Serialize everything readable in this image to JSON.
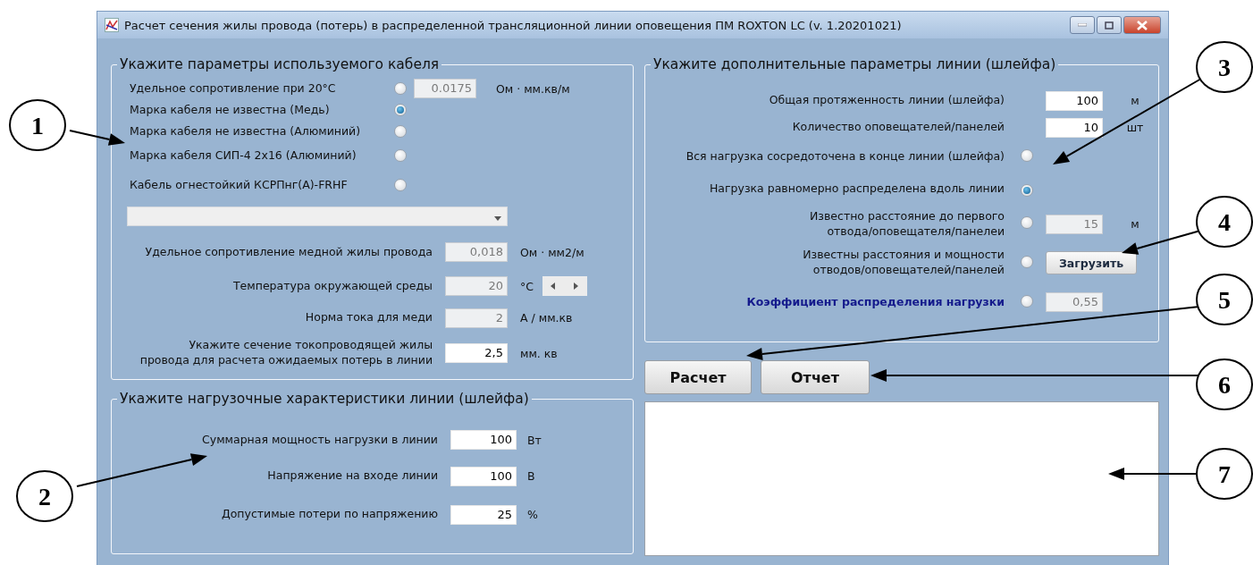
{
  "window": {
    "title": "Расчет сечения жилы провода (потерь) в распределенной трансляционной линии оповещения ПМ ROXTON LC (v. 1.20201021)"
  },
  "cable": {
    "title": "Укажите параметры используемого кабеля",
    "options": [
      {
        "label": "Удельное сопротивление при 20°С",
        "selected": false,
        "value": "0.0175",
        "unit": "Ом · мм.кв/м",
        "disabled": true
      },
      {
        "label": "Марка кабеля не известна (Медь)",
        "selected": true
      },
      {
        "label": "Марка кабеля не известна (Алюминий)",
        "selected": false
      },
      {
        "label": "Марка кабеля  СИП-4 2х16 (Алюминий)",
        "selected": false
      },
      {
        "label": "Кабель огнестойкий КСРПнг(А)-FRHF",
        "selected": false
      }
    ],
    "params": [
      {
        "kind": "field",
        "label": "Удельное сопротивление медной жилы провода",
        "value": "0,018",
        "unit": "Ом · мм2/м",
        "disabled": true
      },
      {
        "kind": "spinner",
        "label": "Температура окружающей среды",
        "value": "20",
        "unit": "°C",
        "disabled": true
      },
      {
        "kind": "field",
        "label": "Норма тока для меди",
        "value": "2",
        "unit": "А / мм.кв",
        "disabled": true
      },
      {
        "kind": "field",
        "label": "Укажите сечение токопроводящей жилы провода для расчета ожидаемых потерь в линии",
        "value": "2,5",
        "unit": "мм. кв",
        "disabled": false
      }
    ]
  },
  "load": {
    "title": "Укажите нагрузочные характеристики линии (шлейфа)",
    "fields": [
      {
        "label": "Суммарная мощность нагрузки в линии",
        "value": "100",
        "unit": "Вт"
      },
      {
        "label": "Напряжение на входе линии",
        "value": "100",
        "unit": "В"
      },
      {
        "label": "Допустимые потери по напряжению",
        "value": "25",
        "unit": "%"
      }
    ]
  },
  "line": {
    "title": "Укажите дополнительные параметры линии (шлейфа)",
    "fields": [
      {
        "label": "Общая протяженность линии (шлейфа)",
        "value": "100",
        "unit": "м"
      },
      {
        "label": "Количество оповещателей/панелей",
        "value": "10",
        "unit": "шт"
      }
    ],
    "options": [
      {
        "kind": "plain",
        "label": "Вся нагрузка сосредоточена в конце линии (шлейфа)",
        "selected": false,
        "highlighted": false
      },
      {
        "kind": "plain",
        "label": "Нагрузка равномерно распределена вдоль линии",
        "selected": true,
        "highlighted": false
      },
      {
        "kind": "field",
        "label": "Известно расстояние до первого отвода/оповещателя/панелеи",
        "selected": false,
        "highlighted": false,
        "value": "15",
        "unit": "м",
        "disabled": true
      },
      {
        "kind": "button",
        "label": "Известны расстояния и мощности отводов/оповещателей/панелей",
        "selected": false,
        "highlighted": false,
        "button": "Загрузить"
      },
      {
        "kind": "field",
        "label": "Коэффициент распределения нагрузки",
        "selected": false,
        "highlighted": true,
        "value": "0,55",
        "disabled": true
      }
    ]
  },
  "actions": [
    {
      "label": "Расчет"
    },
    {
      "label": "Отчет"
    }
  ],
  "callouts": [
    {
      "label": "1"
    },
    {
      "label": "2"
    },
    {
      "label": "3"
    },
    {
      "label": "4"
    },
    {
      "label": "5"
    },
    {
      "label": "6"
    },
    {
      "label": "7"
    }
  ]
}
